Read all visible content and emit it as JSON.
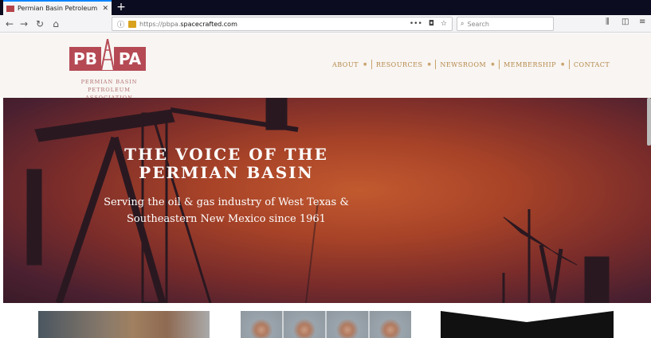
{
  "browser": {
    "tab_title": "Permian Basin Petroleum Asso",
    "url_prefix": "https://pbpa.",
    "url_host": "spacecrafted.com",
    "search_placeholder": "Search",
    "more_label": "•••"
  },
  "header": {
    "logo": {
      "pb": "PB",
      "pa": "PA",
      "name_line1": "PERMIAN BASIN",
      "name_line2": "PETROLEUM ASSOCIATION"
    },
    "nav": [
      {
        "label": "ABOUT",
        "has_menu": true
      },
      {
        "label": "RESOURCES",
        "has_menu": true
      },
      {
        "label": "NEWSROOM",
        "has_menu": true
      },
      {
        "label": "MEMBERSHIP",
        "has_menu": true
      },
      {
        "label": "CONTACT",
        "has_menu": false
      }
    ]
  },
  "hero": {
    "title_line1": "THE VOICE OF THE",
    "title_line2": "PERMIAN BASIN",
    "subtitle_line1": "Serving the oil & gas industry of West Texas &",
    "subtitle_line2": "Southeastern New Mexico since 1961"
  },
  "colors": {
    "brand": "#b54a55",
    "nav_gold": "#b5884a"
  }
}
